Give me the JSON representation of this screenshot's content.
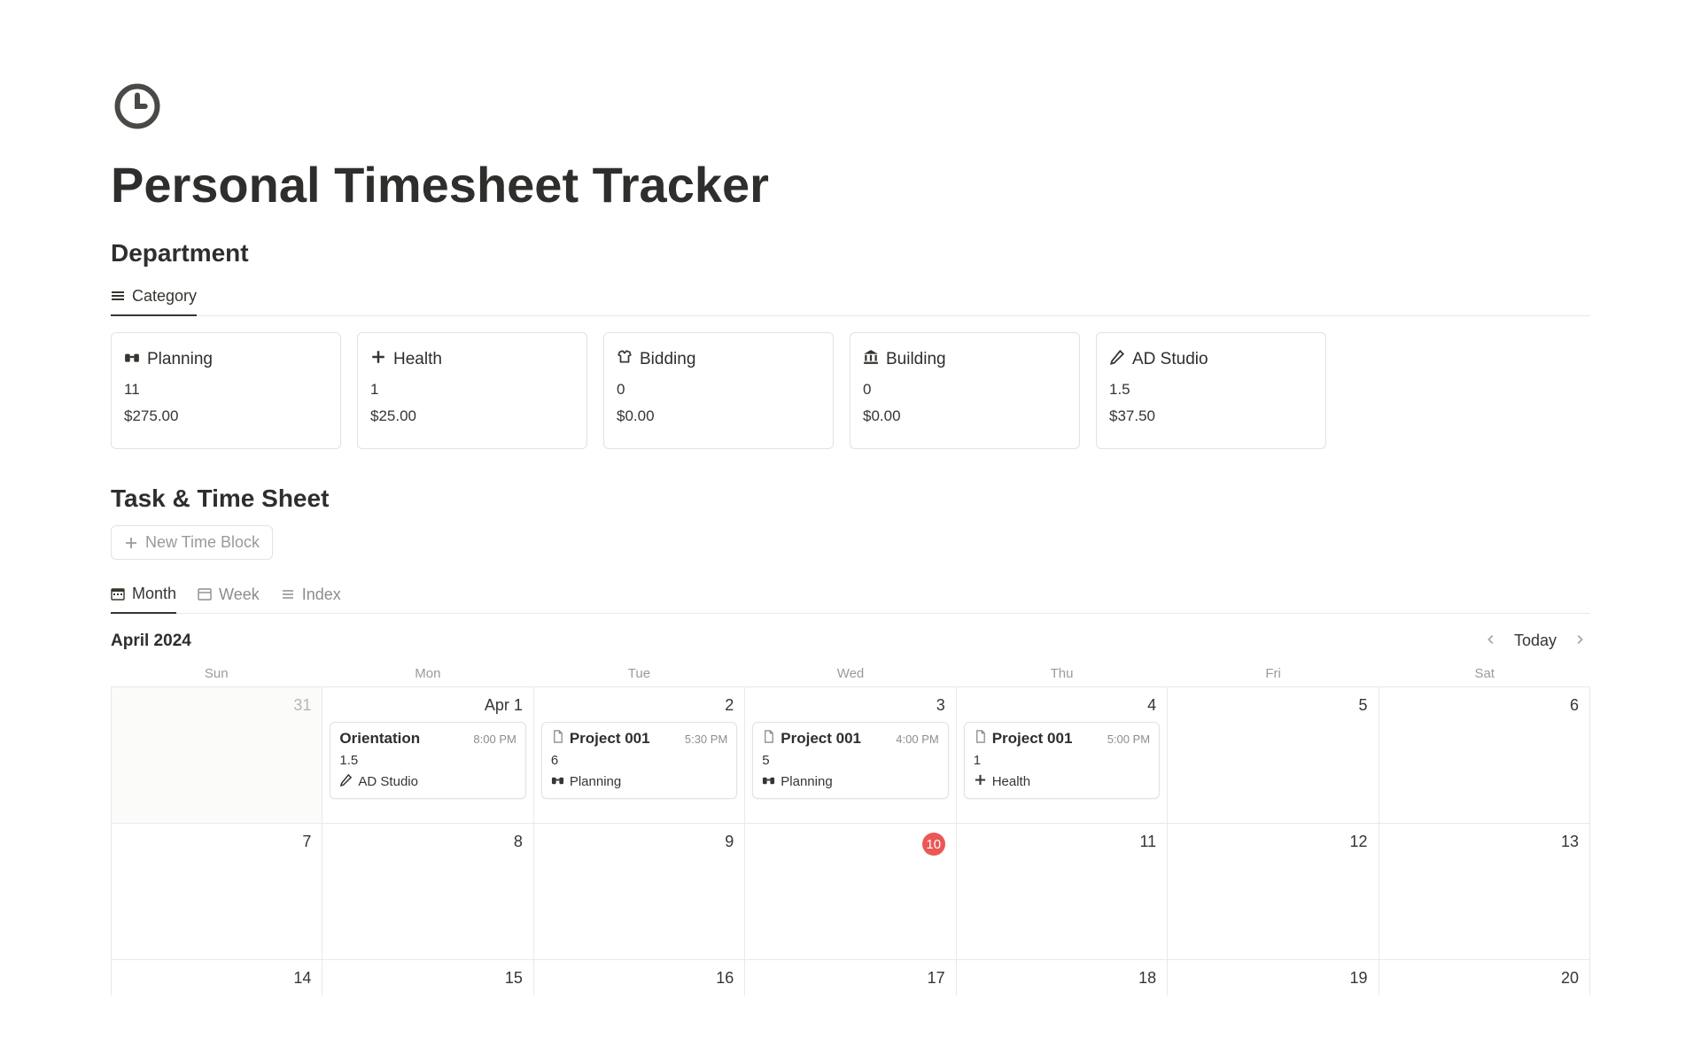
{
  "page_title": "Personal Timesheet Tracker",
  "department": {
    "heading": "Department",
    "tab_label": "Category",
    "cards": [
      {
        "icon": "binoculars",
        "name": "Planning",
        "hours": "11",
        "amount": "$275.00"
      },
      {
        "icon": "plus",
        "name": "Health",
        "hours": "1",
        "amount": "$25.00"
      },
      {
        "icon": "tshirt",
        "name": "Bidding",
        "hours": "0",
        "amount": "$0.00"
      },
      {
        "icon": "bank",
        "name": "Building",
        "hours": "0",
        "amount": "$0.00"
      },
      {
        "icon": "pencil",
        "name": "AD Studio",
        "hours": "1.5",
        "amount": "$37.50"
      }
    ]
  },
  "tasks": {
    "heading": "Task & Time Sheet",
    "new_button": "New Time Block",
    "views": {
      "month": "Month",
      "week": "Week",
      "index": "Index"
    },
    "calendar": {
      "label": "April 2024",
      "today": "Today",
      "dow": [
        "Sun",
        "Mon",
        "Tue",
        "Wed",
        "Thu",
        "Fri",
        "Sat"
      ],
      "row1": [
        "31",
        "Apr 1",
        "2",
        "3",
        "4",
        "5",
        "6"
      ],
      "row2": [
        "7",
        "8",
        "9",
        "10",
        "11",
        "12",
        "13"
      ],
      "row3": [
        "14",
        "15",
        "16",
        "17",
        "18",
        "19",
        "20"
      ],
      "today_index": 10,
      "events": [
        {
          "col": 1,
          "title": "Orientation",
          "time": "8:00 PM",
          "hours": "1.5",
          "dept": "AD Studio",
          "dept_icon": "pencil",
          "title_icon": null
        },
        {
          "col": 2,
          "title": "Project 001",
          "time": "5:30 PM",
          "hours": "6",
          "dept": "Planning",
          "dept_icon": "binoculars",
          "title_icon": "page"
        },
        {
          "col": 3,
          "title": "Project 001",
          "time": "4:00 PM",
          "hours": "5",
          "dept": "Planning",
          "dept_icon": "binoculars",
          "title_icon": "page"
        },
        {
          "col": 4,
          "title": "Project 001",
          "time": "5:00 PM",
          "hours": "1",
          "dept": "Health",
          "dept_icon": "plus",
          "title_icon": "page"
        }
      ]
    }
  }
}
